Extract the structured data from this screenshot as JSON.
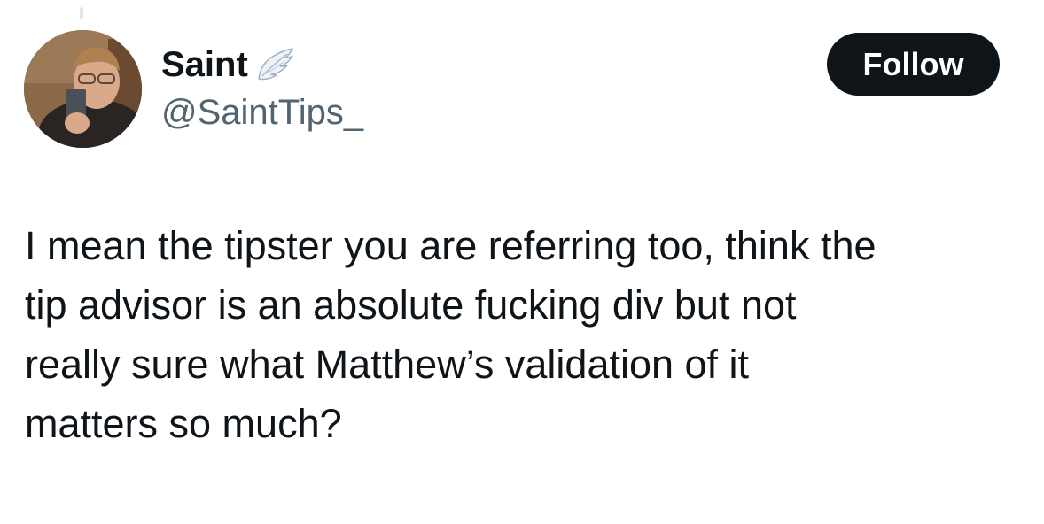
{
  "author": {
    "display_name": "Saint",
    "handle": "@SaintTips_",
    "badge_icon": "angel-wing-icon",
    "avatar_icon": "profile-photo"
  },
  "actions": {
    "follow_label": "Follow"
  },
  "tweet": {
    "lines": [
      "I mean the tipster you are referring too, think the",
      "tip advisor is an absolute fucking div but not",
      "really sure what Matthew’s validation of it",
      "matters so much?"
    ]
  },
  "colors": {
    "text_primary": "#0f1419",
    "text_secondary": "#536471",
    "button_bg": "#0f1419",
    "button_text": "#ffffff",
    "background": "#ffffff"
  }
}
